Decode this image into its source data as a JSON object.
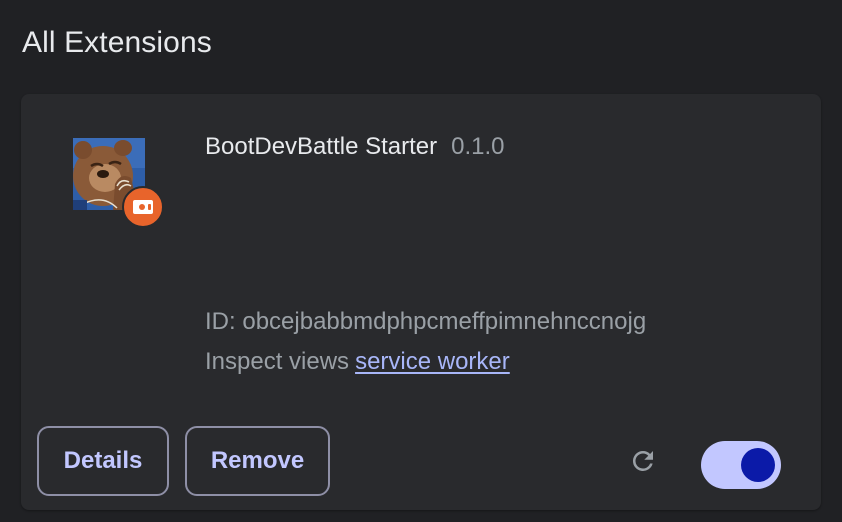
{
  "page": {
    "title": "All Extensions"
  },
  "extension": {
    "name": "BootDevBattle Starter",
    "version": "0.1.0",
    "id_label": "ID:",
    "id_value": "obcejbabbmdphpcmeffpimnehnccnojg",
    "inspect_label": "Inspect views",
    "inspect_link": "service worker",
    "enabled": true
  },
  "actions": {
    "details_label": "Details",
    "remove_label": "Remove"
  },
  "icons": {
    "extension_icon": "bear-avatar-icon",
    "badge_icon": "unpacked-badge-icon",
    "reload_icon": "reload-icon"
  },
  "colors": {
    "background": "#202124",
    "card": "#292a2d",
    "accent": "#c2c7ff",
    "link": "#a8b6f8",
    "badge": "#e8642b",
    "toggle_knob": "#0b1aa8"
  }
}
